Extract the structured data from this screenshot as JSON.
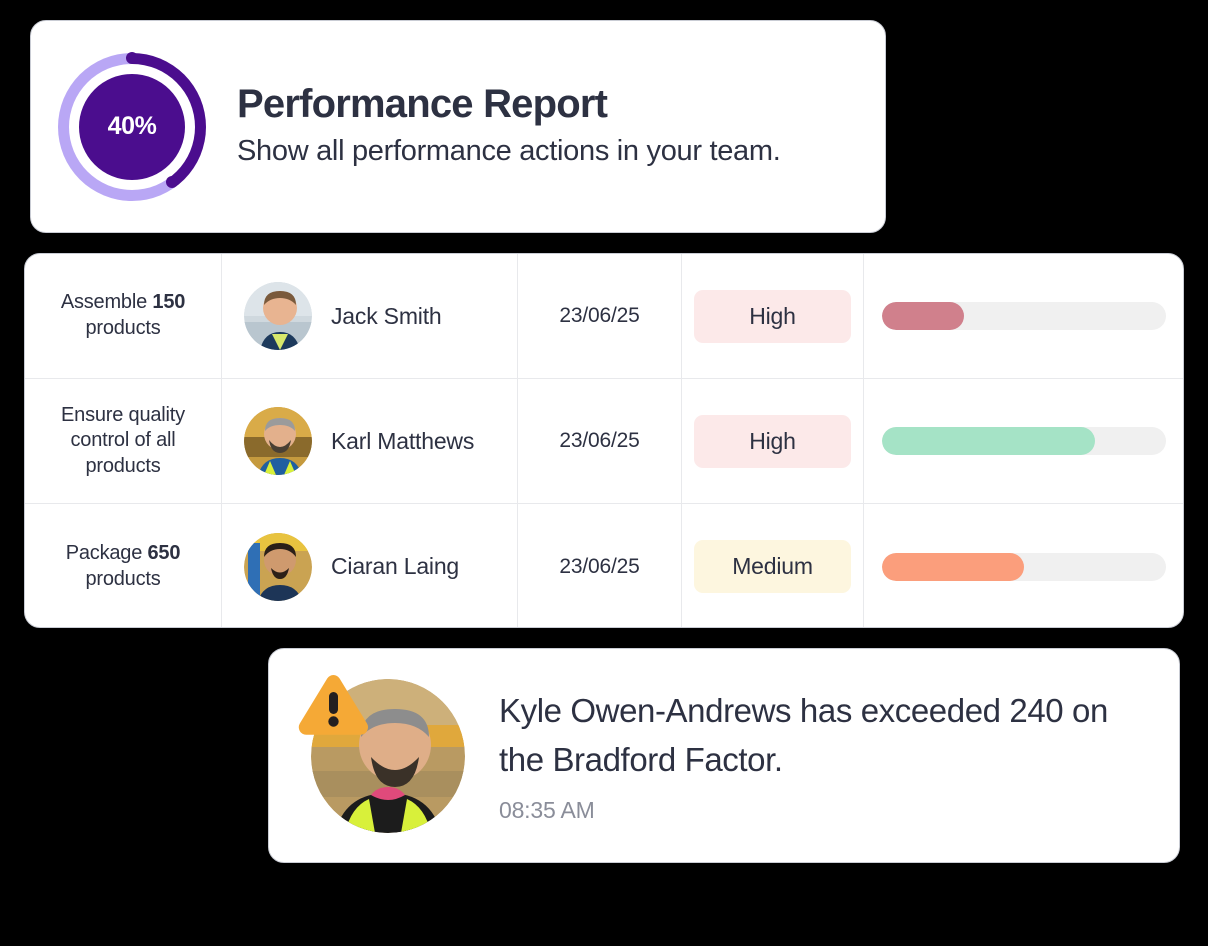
{
  "header": {
    "title": "Performance Report",
    "subtitle": "Show all performance actions in your team.",
    "donut": {
      "label": "40%",
      "percent": 40,
      "arc_color": "#4B0D8E",
      "track_color": "#B9A7F5",
      "core_color": "#4B0D8E"
    }
  },
  "table": {
    "rows": [
      {
        "task_prefix": "Assemble ",
        "task_bold": "150",
        "task_suffix": " products",
        "user": "Jack Smith",
        "avatar": "avatar-jack-smith",
        "date": "23/06/25",
        "priority": "High",
        "priority_bg": "#FCE9E9",
        "progress": 29,
        "progress_color": "#D0808C",
        "track_color": "#F0F0F0"
      },
      {
        "task_prefix": "Ensure quality control of all products",
        "task_bold": "",
        "task_suffix": "",
        "user": "Karl Matthews",
        "avatar": "avatar-karl-matthews",
        "date": "23/06/25",
        "priority": "High",
        "priority_bg": "#FCE9E9",
        "progress": 75,
        "progress_color": "#A5E3C6",
        "track_color": "#F0F0F0"
      },
      {
        "task_prefix": "Package ",
        "task_bold": "650",
        "task_suffix": " products",
        "user": "Ciaran Laing",
        "avatar": "avatar-ciaran-laing",
        "date": "23/06/25",
        "priority": "Medium",
        "priority_bg": "#FDF6DF",
        "progress": 50,
        "progress_color": "#FB9E7C",
        "track_color": "#F0F0F0"
      }
    ]
  },
  "notification": {
    "message": "Kyle Owen-Andrews has exceeded 240 on the Bradford Factor.",
    "time": "08:35 AM",
    "avatar": "avatar-kyle-owen-andrews",
    "warning_icon": "warning-triangle-icon",
    "warning_color": "#F5A936"
  }
}
